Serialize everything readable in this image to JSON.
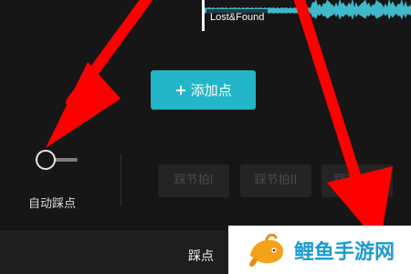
{
  "track": {
    "label": "Lost&Found",
    "waveform_color": "#3fb8c9"
  },
  "add_point": {
    "label": "添加点",
    "icon": "plus-icon",
    "color": "#22b6c8"
  },
  "auto_beat": {
    "label": "自动踩点",
    "enabled": false
  },
  "beat_buttons": [
    "踩节拍I",
    "踩节拍II",
    "踩节拍III"
  ],
  "bottom_bar": {
    "title": "踩点"
  },
  "watermark": {
    "text": "鲤鱼手游网",
    "icon": "fish-logo-icon"
  },
  "annotation": {
    "arrow_color": "#ff0000"
  }
}
